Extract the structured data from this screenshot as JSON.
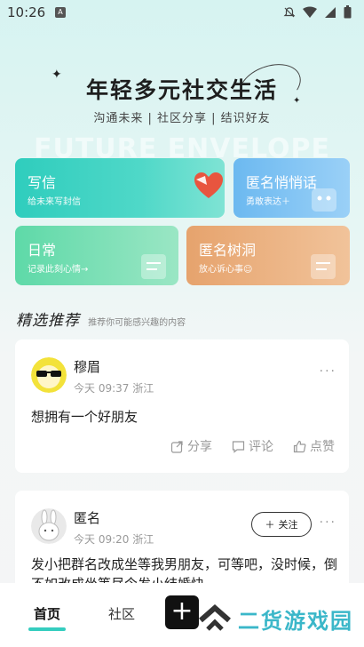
{
  "status": {
    "time": "10:26",
    "app_icon_letter": "A"
  },
  "hero": {
    "title": "年轻多元社交生活",
    "subtitle": "沟通未来 | 社区分享 | 结识好友",
    "watermark": "FUTURE ENVELOPE"
  },
  "cards": {
    "write": {
      "title": "写信",
      "sub": "给未来写封信"
    },
    "anon": {
      "title": "匿名悄悄话",
      "sub": "勇敢表达＋"
    },
    "daily": {
      "title": "日常",
      "sub": "记录此刻心情→"
    },
    "hole": {
      "title": "匿名树洞",
      "sub": "放心诉心事☺"
    }
  },
  "section": {
    "title": "精选推荐",
    "hint": "推荐你可能感兴趣的内容"
  },
  "posts": [
    {
      "user": "穆眉",
      "time": "今天 09:37 浙江",
      "body": "想拥有一个好朋友",
      "share": "分享",
      "comment": "评论",
      "like": "点赞",
      "more": "···"
    },
    {
      "user": "匿名",
      "time": "今天 09:20 浙江",
      "follow": "关注",
      "body": "发小把群名改成坐等我男朋友，可等吧，没时候，倒不如改成坐等尽今发小结婚快",
      "more": "···"
    }
  ],
  "nav": {
    "home": "首页",
    "community": "社区",
    "plus": "+"
  },
  "brand": {
    "text": "二货游戏园"
  },
  "colors": {
    "accent": "#35cdbf",
    "brand": "#3bb7c9"
  }
}
